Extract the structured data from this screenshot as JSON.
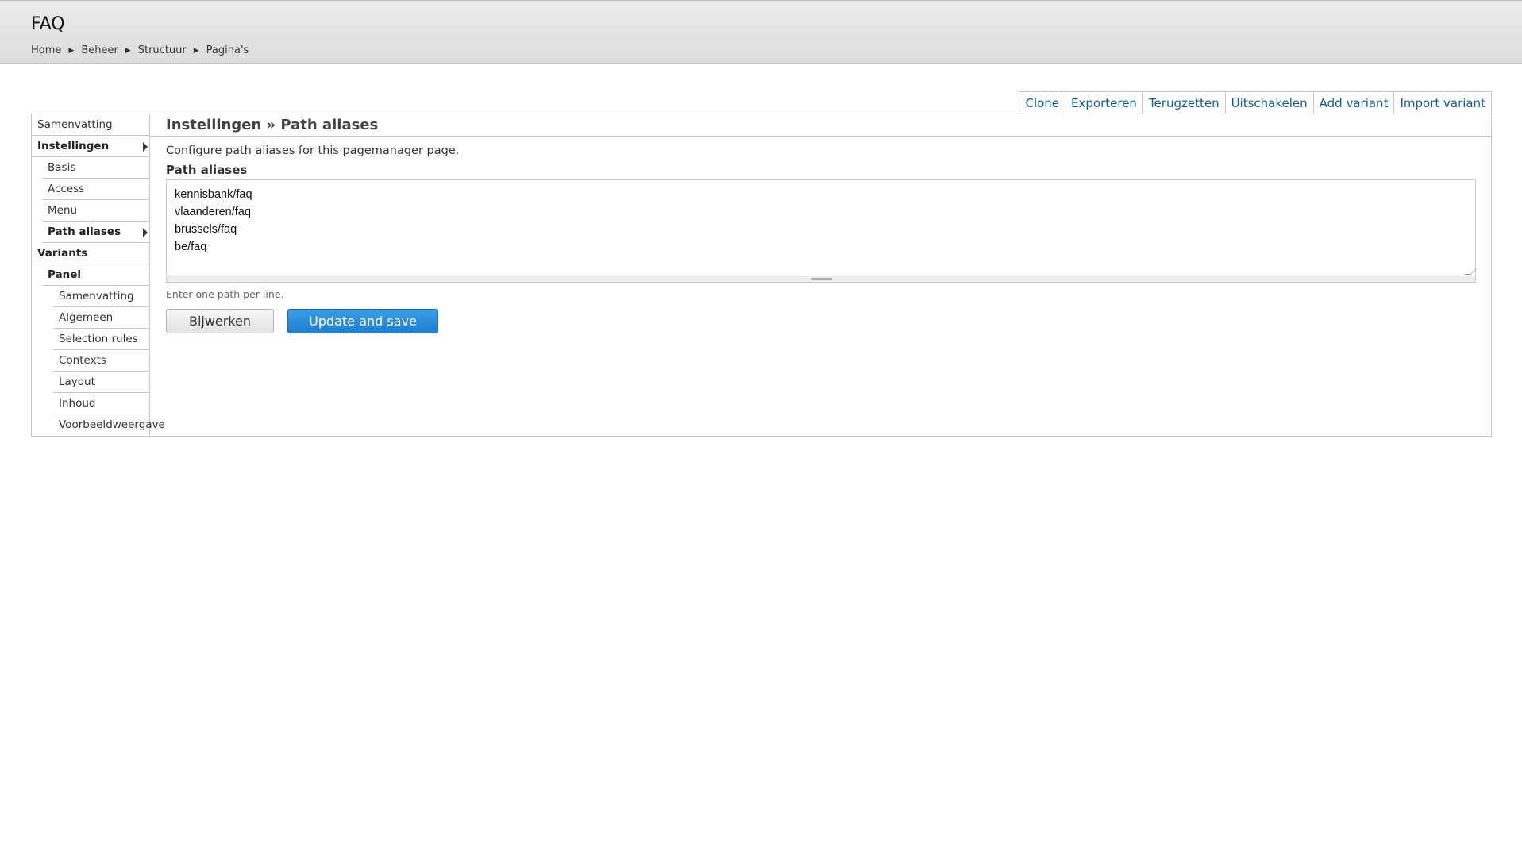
{
  "header": {
    "title": "FAQ",
    "breadcrumb": [
      "Home",
      "Beheer",
      "Structuur",
      "Pagina's"
    ]
  },
  "tabs": [
    "Clone",
    "Exporteren",
    "Terugzetten",
    "Uitschakelen",
    "Add variant",
    "Import variant"
  ],
  "sidebar": {
    "items": [
      {
        "label": "Samenvatting"
      },
      {
        "label": "Instellingen"
      },
      {
        "label": "Basis"
      },
      {
        "label": "Access"
      },
      {
        "label": "Menu"
      },
      {
        "label": "Path aliases"
      },
      {
        "label": "Variants"
      },
      {
        "label": "Panel"
      },
      {
        "label": "Samenvatting"
      },
      {
        "label": "Algemeen"
      },
      {
        "label": "Selection rules"
      },
      {
        "label": "Contexts"
      },
      {
        "label": "Layout"
      },
      {
        "label": "Inhoud"
      },
      {
        "label": "Voorbeeldweergave"
      }
    ]
  },
  "main": {
    "title": "Instellingen » Path aliases",
    "description": "Configure path aliases for this pagemanager page.",
    "field_label": "Path aliases",
    "aliases": [
      "kennisbank/faq",
      "vlaanderen/faq",
      "brussels/faq",
      "be/faq"
    ],
    "help_text": "Enter one path per line.",
    "secondary_button": "Bijwerken",
    "primary_button": "Update and save"
  },
  "colors": {
    "link": "#0d5a9e",
    "primary_button": "#2a8bdc"
  }
}
